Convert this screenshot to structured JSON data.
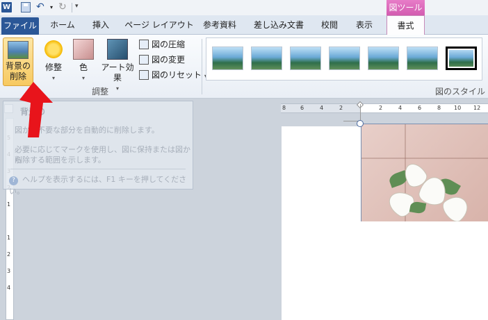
{
  "qat": {
    "app_icon": "W",
    "context_header": "図ツール"
  },
  "tabs": [
    "ファイル",
    "ホーム",
    "挿入",
    "ページ レイアウト",
    "参考資料",
    "差し込み文書",
    "校閲",
    "表示",
    "書式"
  ],
  "ribbon": {
    "bg_remove_l1": "背景の",
    "bg_remove_l2": "削除",
    "corrections": "修整",
    "color": "色",
    "art_effects": "アート効果",
    "compress": "図の圧縮",
    "change": "図の変更",
    "reset": "図のリセット",
    "adjust_group": "調整",
    "styles_group": "図のスタイル"
  },
  "tooltip": {
    "title": "背景の",
    "line1": "図から不要な部分を自動的に削除します。",
    "line2": "必要に応じてマークを使用し、図に保持または図から",
    "line3": "削除する範囲を示します。",
    "help": "ヘルプを表示するには、F1 キーを押してください。"
  },
  "hruler": [
    "8",
    "6",
    "4",
    "2",
    "2",
    "4",
    "6",
    "8",
    "10",
    "12"
  ],
  "vruler": [
    "5",
    "4",
    "3",
    "2",
    "1",
    "1",
    "2",
    "3",
    "4"
  ],
  "icons": {
    "word": "word-app-icon",
    "save": "save-icon",
    "undo": "undo-icon",
    "redo": "redo-icon"
  },
  "colors": {
    "file_tab": "#2b5797",
    "context_tab": "#d35cb0",
    "highlight": "#f7c960",
    "arrow": "#e8141b"
  }
}
